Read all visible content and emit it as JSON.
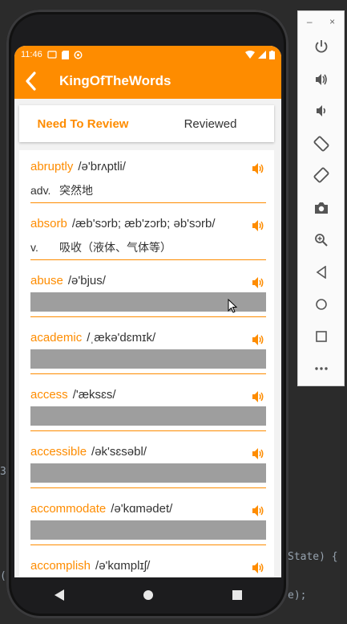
{
  "ide": {
    "code_right_1": "State) {",
    "code_right_2": "e);",
    "code_left_1": "3",
    "code_left_2": "("
  },
  "status_bar": {
    "time": "11:46"
  },
  "app_bar": {
    "title": "KingOfTheWords"
  },
  "tabs": [
    {
      "label": "Need To Review",
      "active": true
    },
    {
      "label": "Reviewed",
      "active": false
    }
  ],
  "words": [
    {
      "word": "abruptly",
      "phonetic": "/ə'brʌptli/",
      "pos": "adv.",
      "meaning": "突然地",
      "revealed": true
    },
    {
      "word": "absorb",
      "phonetic": "/æb'sɔrb; æb'zɔrb; əb'sɔrb/",
      "pos": "v.",
      "meaning": "吸收（液体、气体等）",
      "revealed": true
    },
    {
      "word": "abuse",
      "phonetic": "/ə'bjus/",
      "pos": "",
      "meaning": "",
      "revealed": false
    },
    {
      "word": "academic",
      "phonetic": "/ˌækə'dɛmɪk/",
      "pos": "",
      "meaning": "",
      "revealed": false
    },
    {
      "word": "access",
      "phonetic": "/'æksɛs/",
      "pos": "",
      "meaning": "",
      "revealed": false
    },
    {
      "word": "accessible",
      "phonetic": "/ək'sɛsəbl/",
      "pos": "",
      "meaning": "",
      "revealed": false
    },
    {
      "word": "accommodate",
      "phonetic": "/ə'kɑmədet/",
      "pos": "",
      "meaning": "",
      "revealed": false
    },
    {
      "word": "accomplish",
      "phonetic": "/ə'kɑmplɪʃ/",
      "pos": "",
      "meaning": "",
      "revealed": false
    }
  ],
  "colors": {
    "accent": "#fe8c00",
    "cover": "#9e9e9e"
  },
  "icons": {
    "back": "back-arrow-icon",
    "speaker": "speaker-icon"
  },
  "emulator_toolbar": {
    "minimize": "–",
    "close": "×",
    "buttons": [
      "power-icon",
      "volume-up-icon",
      "volume-down-icon",
      "rotate-left-icon",
      "rotate-right-icon",
      "camera-icon",
      "zoom-icon",
      "back-icon",
      "home-icon",
      "overview-icon",
      "more-icon"
    ]
  }
}
